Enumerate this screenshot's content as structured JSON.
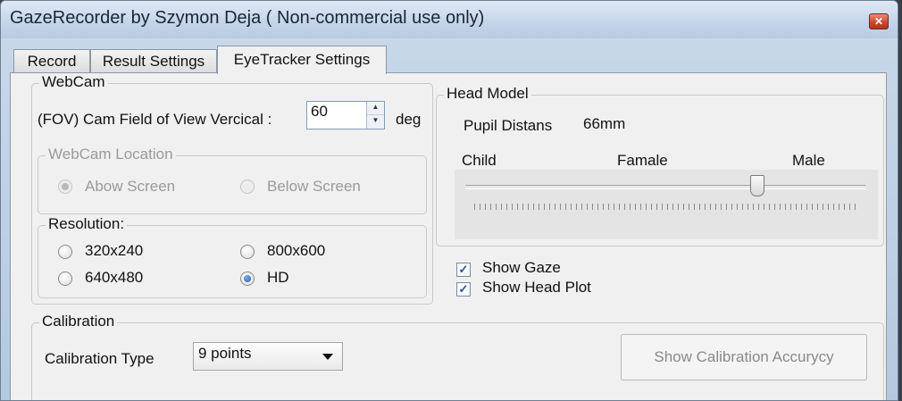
{
  "window": {
    "title": "GazeRecorder   by Szymon Deja  ( Non-commercial use only)",
    "close_symbol": "✕"
  },
  "tabs": [
    {
      "label": "Record",
      "active": false
    },
    {
      "label": "Result Settings",
      "active": false
    },
    {
      "label": "EyeTracker Settings",
      "active": true
    }
  ],
  "webcam": {
    "group_label": "WebCam",
    "fov_label": "(FOV) Cam Field of View Vercical  :",
    "fov_value": "60",
    "fov_unit": "deg",
    "location": {
      "group_label": "WebCam Location",
      "options": [
        {
          "label": "Abow Screen",
          "checked": true
        },
        {
          "label": "Below Screen",
          "checked": false
        }
      ]
    },
    "resolution": {
      "group_label": "Resolution:",
      "options": [
        {
          "label": "320x240",
          "checked": false
        },
        {
          "label": "800x600",
          "checked": false
        },
        {
          "label": "640x480",
          "checked": false
        },
        {
          "label": "HD",
          "checked": true
        }
      ]
    }
  },
  "head_model": {
    "group_label": "Head Model",
    "pupil_label": "Pupil Distans",
    "pupil_value": "66mm",
    "slider_labels": {
      "left": "Child",
      "middle": "Famale",
      "right": "Male"
    },
    "slider_fraction": 0.73
  },
  "options": {
    "show_gaze": {
      "label": "Show Gaze",
      "checked": true
    },
    "show_head_plot": {
      "label": "Show Head Plot",
      "checked": true
    }
  },
  "calibration": {
    "group_label": "Calibration",
    "type_label": "Calibration Type",
    "type_value": "9 points",
    "accuracy_button": "Show Calibration Accurycy"
  },
  "colors": {
    "title_bg": "#c5d6ea",
    "panel_bg": "#f0f0f0",
    "close_button": "#c9442c"
  }
}
